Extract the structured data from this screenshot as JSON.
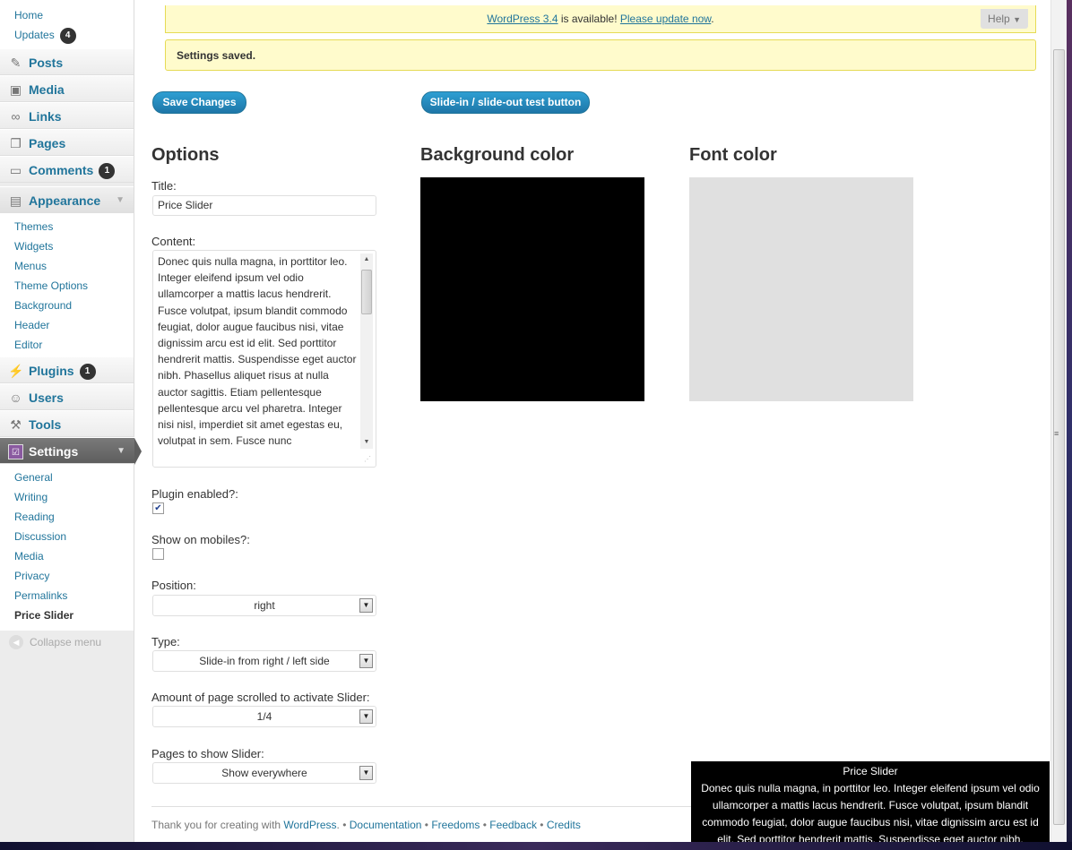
{
  "sidebar": {
    "dashboard_sub": [
      "Home",
      "Updates"
    ],
    "updates_count": "4",
    "menus": {
      "posts": "Posts",
      "media": "Media",
      "links": "Links",
      "pages": "Pages",
      "comments": "Comments",
      "comments_count": "1",
      "appearance": "Appearance",
      "plugins": "Plugins",
      "plugins_count": "1",
      "users": "Users",
      "tools": "Tools",
      "settings": "Settings"
    },
    "appearance_sub": [
      "Themes",
      "Widgets",
      "Menus",
      "Theme Options",
      "Background",
      "Header",
      "Editor"
    ],
    "settings_sub": [
      "General",
      "Writing",
      "Reading",
      "Discussion",
      "Media",
      "Privacy",
      "Permalinks",
      "Price Slider"
    ],
    "collapse_label": "Collapse menu"
  },
  "notices": {
    "update_link": "WordPress 3.4",
    "update_text": " is available! ",
    "update_now": "Please update now",
    "update_end": ".",
    "help": "Help",
    "saved": "Settings saved."
  },
  "buttons": {
    "save": "Save Changes",
    "test": "Slide-in / slide-out test button"
  },
  "options": {
    "heading": "Options",
    "title_label": "Title:",
    "title_value": "Price Slider",
    "content_label": "Content:",
    "content_value": " Donec quis nulla magna, in porttitor leo. Integer eleifend ipsum vel odio ullamcorper a mattis lacus hendrerit. Fusce volutpat, ipsum blandit commodo feugiat, dolor augue faucibus nisi, vitae dignissim arcu est id elit. Sed porttitor hendrerit mattis. Suspendisse eget auctor nibh. Phasellus aliquet risus at nulla auctor sagittis. Etiam pellentesque pellentesque arcu vel pharetra. Integer nisi nisl, imperdiet sit amet egestas eu, volutpat in sem. Fusce nunc",
    "plugin_enabled_label": "Plugin enabled?:",
    "plugin_enabled": true,
    "show_mobiles_label": "Show on mobiles?:",
    "show_mobiles": false,
    "position_label": "Position:",
    "position_value": "right",
    "type_label": "Type:",
    "type_value": "Slide-in from right / left side",
    "scroll_label": "Amount of page scrolled to activate Slider:",
    "scroll_value": "1/4",
    "pages_label": "Pages to show Slider:",
    "pages_value": "Show everywhere"
  },
  "colors": {
    "bg_heading": "Background color",
    "bg_value": "#000000",
    "font_heading": "Font color",
    "font_value": "#e0e0e0"
  },
  "footer": {
    "thanks": "Thank you for creating with ",
    "wordpress": "WordPress",
    "sep": ". • ",
    "documentation": "Documentation",
    "freedoms": "Freedoms",
    "feedback": "Feedback",
    "credits": "Credits"
  },
  "slider_preview": {
    "title": "Price Slider",
    "text": "Donec quis nulla magna, in porttitor leo. Integer eleifend ipsum vel odio ullamcorper a mattis lacus hendrerit. Fusce volutpat, ipsum blandit commodo feugiat, dolor augue faucibus nisi, vitae dignissim arcu est id elit. Sed porttitor hendrerit mattis. Suspendisse eget auctor nibh."
  }
}
